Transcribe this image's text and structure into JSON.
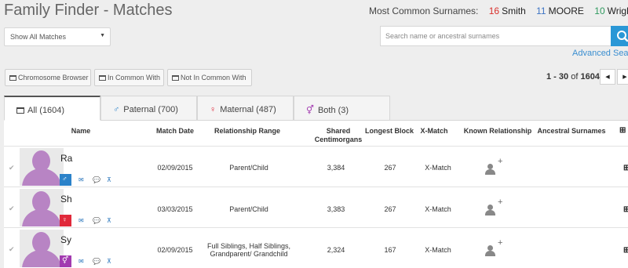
{
  "header": {
    "title": "Family Finder - Matches",
    "surnames_label": "Most Common Surnames:",
    "surnames": [
      {
        "count": "16",
        "name": "Smith",
        "color": "#d9302c"
      },
      {
        "count": "11",
        "name": "MOORE",
        "color": "#3e74c4"
      },
      {
        "count": "10",
        "name": "Wrigh",
        "color": "#2e9a5e"
      }
    ]
  },
  "filter": {
    "selected": "Show All Matches"
  },
  "search": {
    "placeholder": "Search name or ancestral surnames",
    "advanced_label": "Advanced Searc"
  },
  "toolbar": {
    "chromosome_browser": "Chromosome Browser",
    "in_common_with": "In Common With",
    "not_in_common_with": "Not In Common With"
  },
  "pager": {
    "range": "1 - 30",
    "of": "of",
    "total": "1604"
  },
  "tabs": [
    {
      "label": "All (1604)",
      "icon": "list-icon"
    },
    {
      "label": "Paternal (700)",
      "icon": "male-icon"
    },
    {
      "label": "Maternal (487)",
      "icon": "female-icon"
    },
    {
      "label": "Both (3)",
      "icon": "both-icon"
    }
  ],
  "columns": {
    "name": "Name",
    "match_date": "Match Date",
    "relationship_range": "Relationship Range",
    "shared_cm_1": "Shared",
    "shared_cm_2": "Centimorgans",
    "longest_block": "Longest Block",
    "x_match": "X-Match",
    "known_relationship": "Known Relationship",
    "ancestral_surnames": "Ancestral Surnames"
  },
  "rows": [
    {
      "name": "Ra",
      "gender": "male",
      "gender_glyph": "♂",
      "match_date": "02/09/2015",
      "relationship_1": "Parent/Child",
      "relationship_2": "",
      "shared_cm": "3,384",
      "longest_block": "267",
      "x_match": "X-Match"
    },
    {
      "name": "Sh",
      "gender": "female",
      "gender_glyph": "♀",
      "match_date": "03/03/2015",
      "relationship_1": "Parent/Child",
      "relationship_2": "",
      "shared_cm": "3,383",
      "longest_block": "267",
      "x_match": "X-Match"
    },
    {
      "name": "Sy",
      "gender": "both",
      "gender_glyph": "⚥",
      "match_date": "02/09/2015",
      "relationship_1": "Full Siblings, Half Siblings,",
      "relationship_2": "Grandparent/ Grandchild",
      "shared_cm": "2,324",
      "longest_block": "167",
      "x_match": "X-Match"
    }
  ]
}
